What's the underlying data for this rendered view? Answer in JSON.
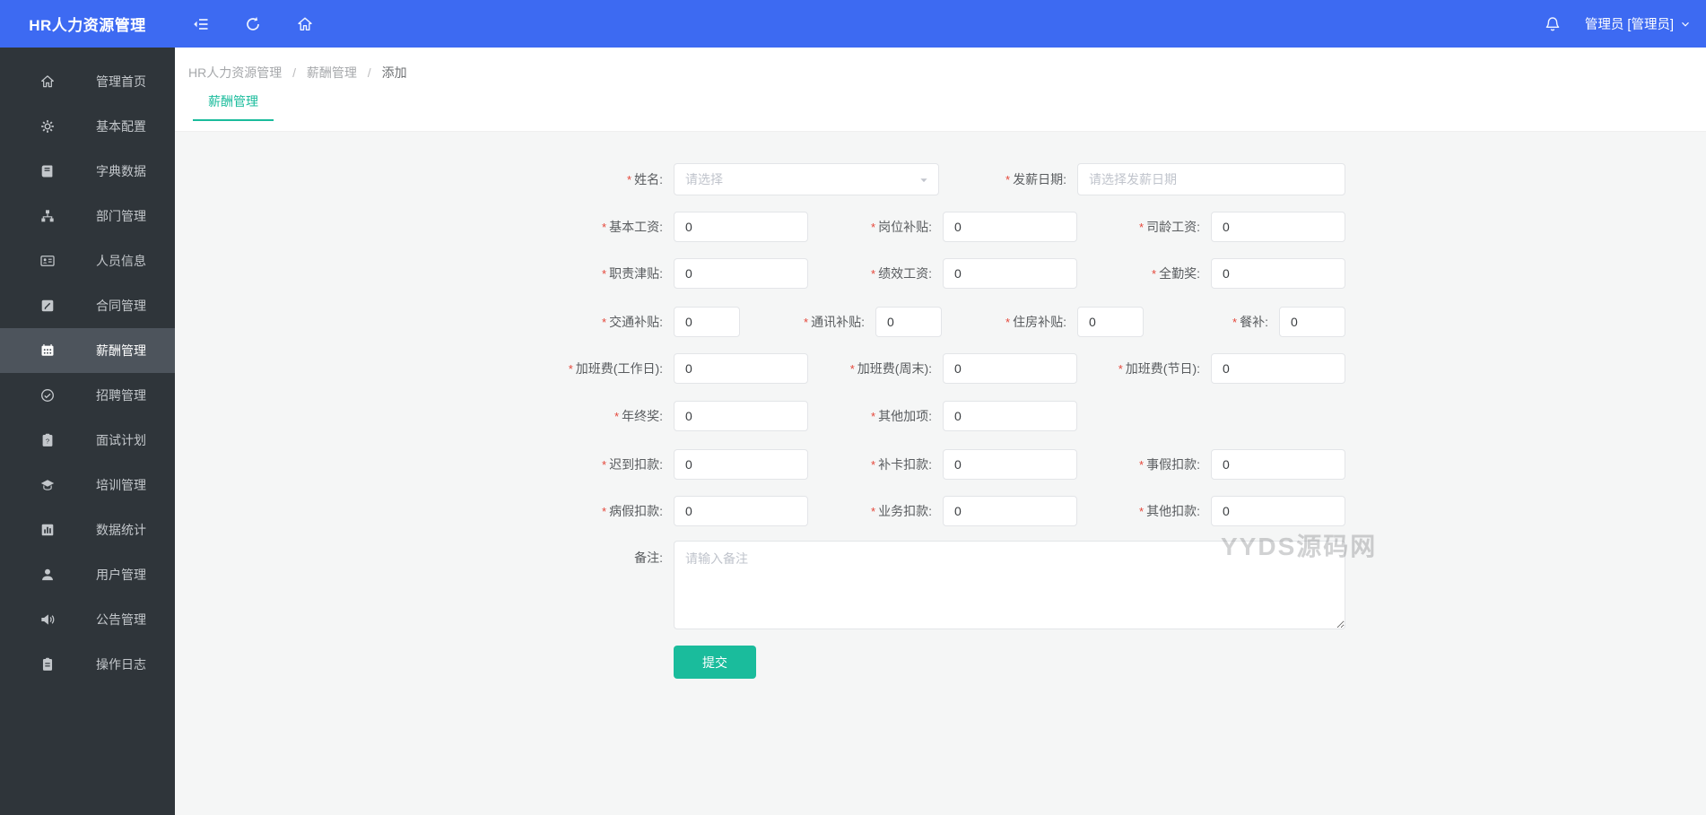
{
  "app": {
    "title": "HR人力资源管理"
  },
  "topbar": {
    "user_label": "管理员 [管理员]"
  },
  "sidebar": {
    "items": [
      {
        "label": "管理首页",
        "icon": "home-icon"
      },
      {
        "label": "基本配置",
        "icon": "gear-icon"
      },
      {
        "label": "字典数据",
        "icon": "book-icon"
      },
      {
        "label": "部门管理",
        "icon": "sitemap-icon"
      },
      {
        "label": "人员信息",
        "icon": "id-card-icon"
      },
      {
        "label": "合同管理",
        "icon": "contract-icon"
      },
      {
        "label": "薪酬管理",
        "icon": "salary-icon",
        "active": true
      },
      {
        "label": "招聘管理",
        "icon": "recruit-icon"
      },
      {
        "label": "面试计划",
        "icon": "interview-icon"
      },
      {
        "label": "培训管理",
        "icon": "training-icon"
      },
      {
        "label": "数据统计",
        "icon": "stats-icon"
      },
      {
        "label": "用户管理",
        "icon": "user-icon"
      },
      {
        "label": "公告管理",
        "icon": "announcement-icon"
      },
      {
        "label": "操作日志",
        "icon": "logs-icon"
      }
    ]
  },
  "breadcrumb": {
    "items": [
      "HR人力资源管理",
      "薪酬管理",
      "添加"
    ],
    "separator": "/"
  },
  "tab": {
    "label": "薪酬管理"
  },
  "form": {
    "required_mark": "*",
    "fields": {
      "name": {
        "label": "姓名:",
        "placeholder": "请选择"
      },
      "payday": {
        "label": "发薪日期:",
        "placeholder": "请选择发薪日期"
      },
      "base_salary": {
        "label": "基本工资:",
        "value": "0"
      },
      "post_allowance": {
        "label": "岗位补贴:",
        "value": "0"
      },
      "seniority_salary": {
        "label": "司龄工资:",
        "value": "0"
      },
      "duty_allowance": {
        "label": "职责津贴:",
        "value": "0"
      },
      "performance_salary": {
        "label": "绩效工资:",
        "value": "0"
      },
      "full_attendance_bonus": {
        "label": "全勤奖:",
        "value": "0"
      },
      "transport_allowance": {
        "label": "交通补贴:",
        "value": "0"
      },
      "communication_allowance": {
        "label": "通讯补贴:",
        "value": "0"
      },
      "housing_allowance": {
        "label": "住房补贴:",
        "value": "0"
      },
      "meal_allowance": {
        "label": "餐补:",
        "value": "0"
      },
      "overtime_workday": {
        "label": "加班费(工作日):",
        "value": "0"
      },
      "overtime_weekend": {
        "label": "加班费(周末):",
        "value": "0"
      },
      "overtime_holiday": {
        "label": "加班费(节日):",
        "value": "0"
      },
      "year_end_bonus": {
        "label": "年终奖:",
        "value": "0"
      },
      "other_additions": {
        "label": "其他加项:",
        "value": "0"
      },
      "late_deduction": {
        "label": "迟到扣款:",
        "value": "0"
      },
      "makeup_card_deduction": {
        "label": "补卡扣款:",
        "value": "0"
      },
      "personal_leave_deduction": {
        "label": "事假扣款:",
        "value": "0"
      },
      "sick_leave_deduction": {
        "label": "病假扣款:",
        "value": "0"
      },
      "business_deduction": {
        "label": "业务扣款:",
        "value": "0"
      },
      "other_deduction": {
        "label": "其他扣款:",
        "value": "0"
      },
      "remark": {
        "label": "备注:",
        "placeholder": "请输入备注"
      }
    },
    "submit_label": "提交"
  },
  "watermark": {
    "text": "YYDS源码网"
  },
  "colors": {
    "navbar_blue": "#3d6af2",
    "sidebar_dark": "#2f353a",
    "accent_teal": "#1abc9c",
    "panel_bg": "#f5f6f6",
    "required_red": "#e5473a"
  }
}
